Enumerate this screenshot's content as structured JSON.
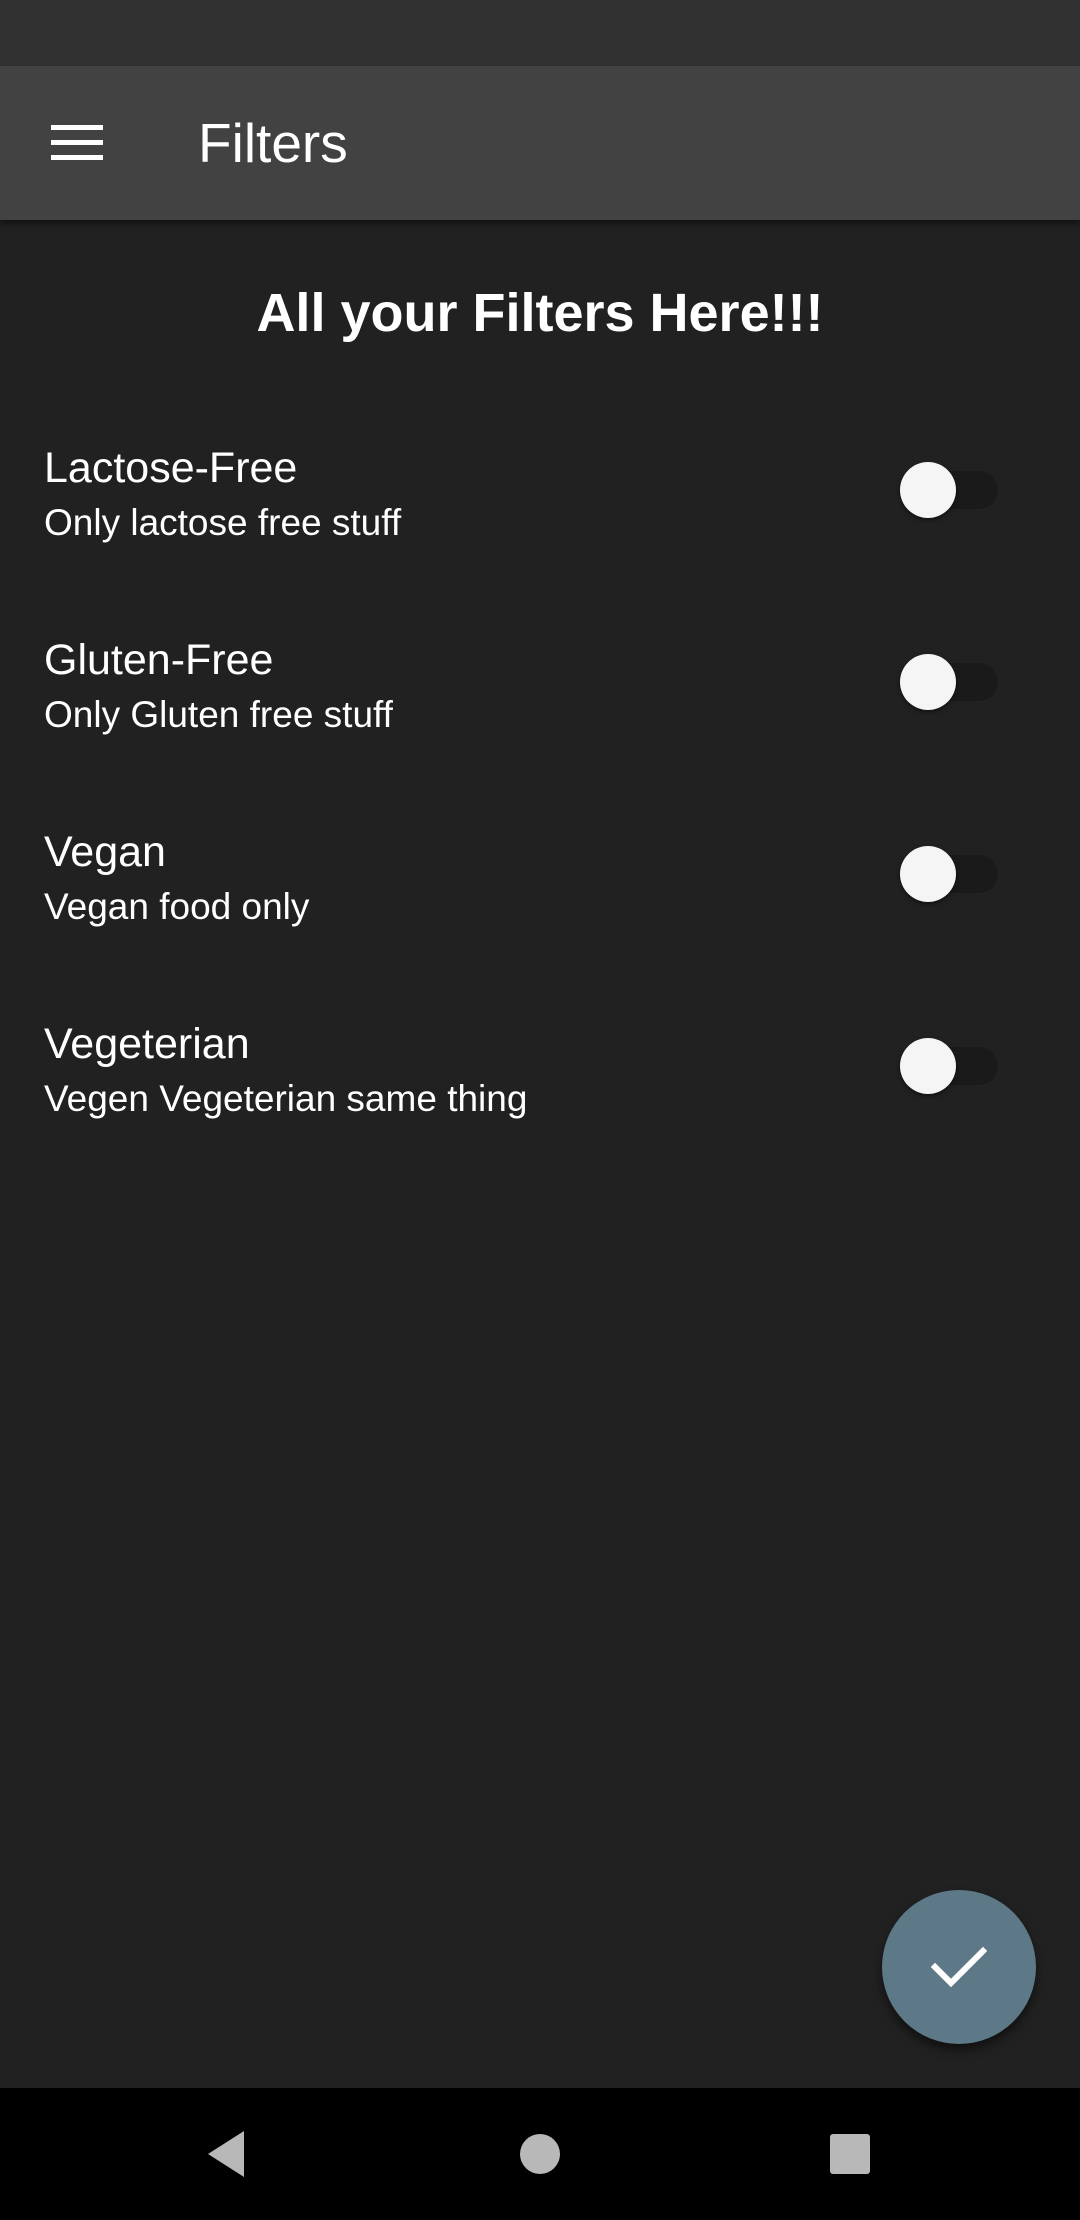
{
  "app_bar": {
    "title": "Filters",
    "menu_icon": "menu-icon"
  },
  "main": {
    "heading": "All your Filters Here!!!",
    "filters": [
      {
        "title": "Lactose-Free",
        "subtitle": "Only lactose free stuff",
        "enabled": false
      },
      {
        "title": "Gluten-Free",
        "subtitle": "Only Gluten free stuff",
        "enabled": false
      },
      {
        "title": "Vegan",
        "subtitle": "Vegan food only",
        "enabled": false
      },
      {
        "title": "Vegeterian",
        "subtitle": "Vegen Vegeterian same thing",
        "enabled": false
      }
    ]
  },
  "fab": {
    "icon": "check-icon",
    "color": "#5d7887"
  },
  "nav_bar": {
    "icons": [
      "back-icon",
      "home-icon",
      "recents-icon"
    ]
  },
  "colors": {
    "background": "#212121",
    "app_bar": "#424242",
    "status_bar": "#313131"
  }
}
